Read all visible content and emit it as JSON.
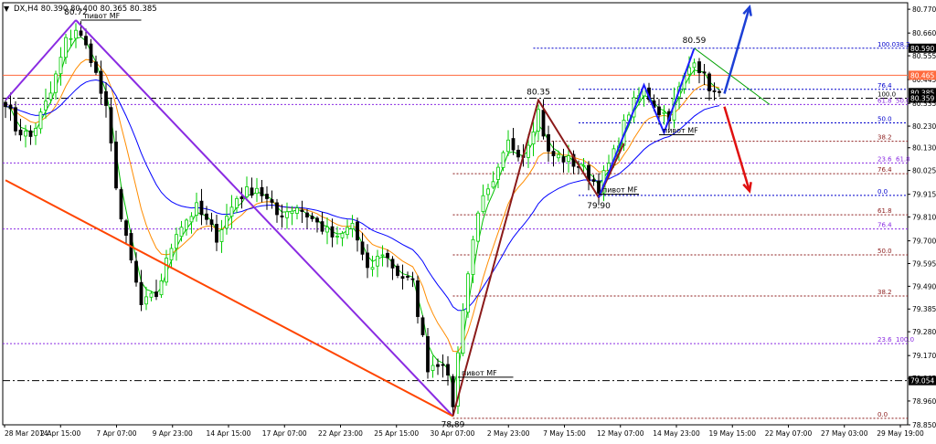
{
  "header": {
    "menu_glyph": "▼",
    "symbol_line": "DX,H4  80.390 80.400 80.365 80.385"
  },
  "colors": {
    "bull": "#00cc00",
    "bear": "#000000",
    "ma_fast": "#00c000",
    "ma_mid": "#ff8c00",
    "ma_slow": "#0000ff",
    "wave_purple": "#8a2be2",
    "wave_red": "#ff4500",
    "zigzag_dark": "#8b1a1a",
    "zigzag_blue": "#1c1cff",
    "arrow_up": "#1c3fd6",
    "arrow_down": "#e01010"
  },
  "chart_data": {
    "type": "candlestick",
    "symbol": "DX",
    "timeframe": "H4",
    "ohlc_readout": {
      "open": 80.39,
      "high": 80.4,
      "low": 80.365,
      "close": 80.385
    },
    "ylim": [
      78.85,
      80.8
    ],
    "y_ticks": [
      "80.770",
      "80.660",
      "80.555",
      "80.445",
      "80.335",
      "80.230",
      "80.130",
      "80.025",
      "79.915",
      "79.810",
      "79.700",
      "79.595",
      "79.490",
      "79.385",
      "79.280",
      "79.170",
      "79.065",
      "78.960",
      "78.850"
    ],
    "x_ticks": [
      "28 Mar 2014",
      "2 Apr 15:00",
      "7 Apr 07:00",
      "9 Apr 23:00",
      "14 Apr 15:00",
      "17 Apr 07:00",
      "22 Apr 23:00",
      "25 Apr 15:00",
      "30 Apr 07:00",
      "2 May 23:00",
      "7 May 15:00",
      "12 May 07:00",
      "14 May 23:00",
      "19 May 15:00",
      "22 May 07:00",
      "27 May 03:00",
      "29 May 19:00"
    ],
    "price_labels": [
      {
        "value": 80.59,
        "text": "80.590",
        "bg": "#000000",
        "fg": "#ffffff"
      },
      {
        "value": 80.465,
        "text": "80.465",
        "bg": "#ff6a3d",
        "fg": "#ffffff"
      },
      {
        "value": 80.385,
        "text": "80.385",
        "bg": "#000000",
        "fg": "#ffffff"
      },
      {
        "value": 80.359,
        "text": "80.359",
        "bg": "#000000",
        "fg": "#ffffff"
      },
      {
        "value": 79.054,
        "text": "79.054",
        "bg": "#000000",
        "fg": "#ffffff"
      }
    ],
    "annotations": [
      {
        "text": "80.72",
        "bar": 14,
        "value": 80.72,
        "pos": "above"
      },
      {
        "text": "80.35",
        "bar": 106,
        "value": 80.35,
        "pos": "above"
      },
      {
        "text": "80.59",
        "bar": 137,
        "value": 80.59,
        "pos": "above"
      },
      {
        "text": "79.90",
        "bar": 118,
        "value": 79.9,
        "pos": "below"
      },
      {
        "text": "78.89",
        "bar": 89,
        "value": 78.89,
        "pos": "below"
      }
    ],
    "pivots": [
      {
        "text": "пивот MF",
        "bar_start": 15,
        "bar_end": 27,
        "value": 80.72
      },
      {
        "text": "пивот MF",
        "bar_start": 90,
        "bar_end": 101,
        "value": 79.07
      },
      {
        "text": "пивот MF",
        "bar_start": 118,
        "bar_end": 126,
        "value": 79.915
      },
      {
        "text": "пивот MF",
        "bar_start": 130,
        "bar_end": 137,
        "value": 80.19
      }
    ],
    "fib_levels": [
      {
        "value": 80.59,
        "label": "100.0",
        "label2": "38.2",
        "color": "#0000cc",
        "dash": "2,2",
        "x_bar": 105
      },
      {
        "value": 80.465,
        "label": "",
        "label2": "",
        "color": "#ff6a3d",
        "dash": "",
        "x_bar": 0
      },
      {
        "value": 80.4,
        "label": "76.4",
        "label2": "",
        "color": "#0000cc",
        "dash": "2,2",
        "x_bar": 114
      },
      {
        "value": 80.359,
        "label": "100.0",
        "label2": "",
        "color": "#000000",
        "dash": "8,3,2,3",
        "x_bar": 0
      },
      {
        "value": 80.33,
        "label": "61.8",
        "label2": "50.0",
        "color": "#8a2be2",
        "dash": "2,2",
        "x_bar": 0
      },
      {
        "value": 80.245,
        "label": "50.0",
        "label2": "",
        "color": "#0000cc",
        "dash": "2,2",
        "x_bar": 114
      },
      {
        "value": 80.16,
        "label": "38.2",
        "label2": "",
        "color": "#8b1a1a",
        "dash": "2,2",
        "x_bar": 105
      },
      {
        "value": 80.06,
        "label": "23.6",
        "label2": "61.8",
        "color": "#8a2be2",
        "dash": "2,2",
        "x_bar": 0
      },
      {
        "value": 80.01,
        "label": "76.4",
        "label2": "",
        "color": "#8b1a1a",
        "dash": "2,2",
        "x_bar": 89
      },
      {
        "value": 79.91,
        "label": "0.0",
        "label2": "",
        "color": "#0000cc",
        "dash": "2,2",
        "x_bar": 114
      },
      {
        "value": 79.82,
        "label": "61.8",
        "label2": "",
        "color": "#8b1a1a",
        "dash": "2,2",
        "x_bar": 89
      },
      {
        "value": 79.755,
        "label": "76.4",
        "label2": "",
        "color": "#8a2be2",
        "dash": "2,2",
        "x_bar": 0
      },
      {
        "value": 79.635,
        "label": "50.0",
        "label2": "",
        "color": "#8b1a1a",
        "dash": "2,2",
        "x_bar": 89
      },
      {
        "value": 79.445,
        "label": "38.2",
        "label2": "",
        "color": "#8b1a1a",
        "dash": "2,2",
        "x_bar": 89
      },
      {
        "value": 79.225,
        "label": "23.6",
        "label2": "100.0",
        "color": "#8a2be2",
        "dash": "2,2",
        "x_bar": 0
      },
      {
        "value": 79.054,
        "label": "",
        "label2": "",
        "color": "#000000",
        "dash": "8,3,2,3",
        "x_bar": 0
      },
      {
        "value": 78.88,
        "label": "0.0",
        "label2": "",
        "color": "#8b1a1a",
        "dash": "2,2",
        "x_bar": 89
      }
    ],
    "wave_lines": [
      {
        "name": "purple-up",
        "color": "#8a2be2",
        "points": [
          [
            0,
            80.35
          ],
          [
            14,
            80.72
          ]
        ]
      },
      {
        "name": "purple-down",
        "color": "#8a2be2",
        "points": [
          [
            14,
            80.72
          ],
          [
            89,
            78.89
          ]
        ]
      },
      {
        "name": "red-trend",
        "color": "#ff4500",
        "points": [
          [
            0,
            79.98
          ],
          [
            89,
            78.89
          ]
        ]
      },
      {
        "name": "zigzag-dark",
        "color": "#8b1a1a",
        "points": [
          [
            89,
            78.89
          ],
          [
            106,
            80.35
          ],
          [
            118,
            79.9
          ],
          [
            123,
            80.15
          ]
        ]
      },
      {
        "name": "zigzag-blue",
        "color": "#1c1cff",
        "points": [
          [
            118,
            79.9
          ],
          [
            127,
            80.42
          ],
          [
            131,
            80.2
          ],
          [
            137,
            80.59
          ]
        ]
      },
      {
        "name": "green-channel",
        "color": "#00a000",
        "points": [
          [
            137,
            80.59
          ],
          [
            152,
            80.33
          ]
        ]
      }
    ],
    "arrows": [
      {
        "name": "arrow-up",
        "color": "#1c3fd6",
        "from": [
          143,
          80.38
        ],
        "to": [
          148,
          80.78
        ]
      },
      {
        "name": "arrow-down",
        "color": "#e01010",
        "from": [
          143,
          80.32
        ],
        "to": [
          148,
          79.93
        ]
      }
    ],
    "anchors": [
      {
        "bar": 0,
        "value": 80.35
      },
      {
        "bar": 2,
        "value": 80.22
      },
      {
        "bar": 5,
        "value": 80.18
      },
      {
        "bar": 9,
        "value": 80.38
      },
      {
        "bar": 12,
        "value": 80.62
      },
      {
        "bar": 14,
        "value": 80.68
      },
      {
        "bar": 17,
        "value": 80.55
      },
      {
        "bar": 20,
        "value": 80.3
      },
      {
        "bar": 23,
        "value": 79.8
      },
      {
        "bar": 27,
        "value": 79.4
      },
      {
        "bar": 30,
        "value": 79.45
      },
      {
        "bar": 34,
        "value": 79.75
      },
      {
        "bar": 38,
        "value": 79.85
      },
      {
        "bar": 42,
        "value": 79.72
      },
      {
        "bar": 46,
        "value": 79.9
      },
      {
        "bar": 50,
        "value": 79.95
      },
      {
        "bar": 54,
        "value": 79.82
      },
      {
        "bar": 58,
        "value": 79.86
      },
      {
        "bar": 62,
        "value": 79.78
      },
      {
        "bar": 66,
        "value": 79.7
      },
      {
        "bar": 69,
        "value": 79.78
      },
      {
        "bar": 72,
        "value": 79.55
      },
      {
        "bar": 75,
        "value": 79.65
      },
      {
        "bar": 78,
        "value": 79.55
      },
      {
        "bar": 81,
        "value": 79.5
      },
      {
        "bar": 84,
        "value": 79.12
      },
      {
        "bar": 87,
        "value": 79.15
      },
      {
        "bar": 89,
        "value": 78.95
      },
      {
        "bar": 91,
        "value": 79.4
      },
      {
        "bar": 94,
        "value": 79.85
      },
      {
        "bar": 97,
        "value": 79.95
      },
      {
        "bar": 100,
        "value": 80.15
      },
      {
        "bar": 103,
        "value": 80.1
      },
      {
        "bar": 106,
        "value": 80.3
      },
      {
        "bar": 108,
        "value": 80.1
      },
      {
        "bar": 111,
        "value": 80.08
      },
      {
        "bar": 114,
        "value": 80.05
      },
      {
        "bar": 118,
        "value": 79.95
      },
      {
        "bar": 121,
        "value": 80.1
      },
      {
        "bar": 124,
        "value": 80.3
      },
      {
        "bar": 127,
        "value": 80.4
      },
      {
        "bar": 130,
        "value": 80.3
      },
      {
        "bar": 132,
        "value": 80.28
      },
      {
        "bar": 134,
        "value": 80.4
      },
      {
        "bar": 137,
        "value": 80.55
      },
      {
        "bar": 139,
        "value": 80.45
      },
      {
        "bar": 141,
        "value": 80.38
      },
      {
        "bar": 142,
        "value": 80.385
      }
    ],
    "bar_count": 143,
    "grid": false
  }
}
